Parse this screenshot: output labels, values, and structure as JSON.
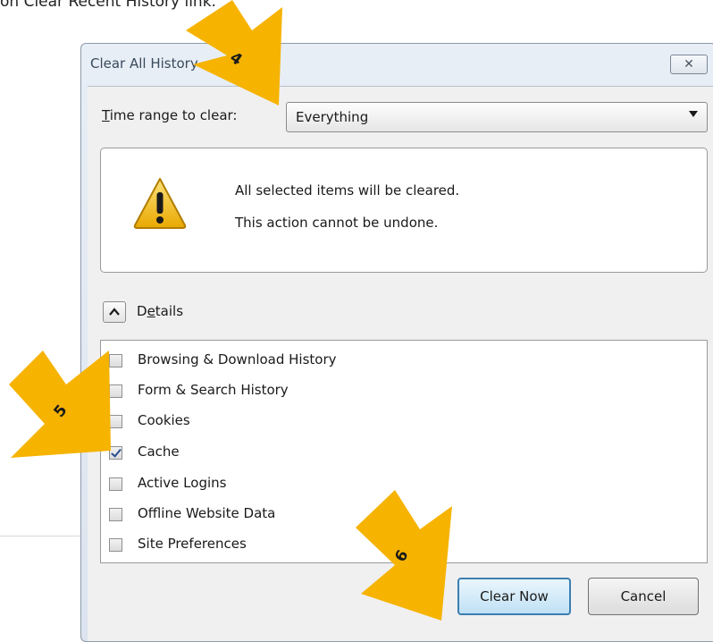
{
  "intro_text": "on Clear Recent History link.",
  "dialog": {
    "title": "Clear All History",
    "close_glyph": "✕"
  },
  "time_range": {
    "label_accel": "T",
    "label_rest": "ime range to clear:",
    "value": "Everything"
  },
  "warning": {
    "icon": "warning-icon",
    "line1": "All selected items will be cleared.",
    "line2": "This action cannot be undone."
  },
  "details": {
    "label_before": "D",
    "label_accel": "e",
    "label_after": "tails",
    "expanded": true
  },
  "items": [
    {
      "label": "Browsing & Download History",
      "checked": false
    },
    {
      "label": "Form & Search History",
      "checked": false
    },
    {
      "label": "Cookies",
      "checked": false
    },
    {
      "label": "Cache",
      "checked": true
    },
    {
      "label": "Active Logins",
      "checked": false
    },
    {
      "label": "Offline Website Data",
      "checked": false
    },
    {
      "label": "Site Preferences",
      "checked": false
    }
  ],
  "buttons": {
    "clear_now": "Clear Now",
    "cancel": "Cancel"
  },
  "callouts": [
    {
      "number": "4"
    },
    {
      "number": "5"
    },
    {
      "number": "6"
    }
  ],
  "colors": {
    "callout": "#f6b300",
    "warning_fill": "#f5c518"
  }
}
